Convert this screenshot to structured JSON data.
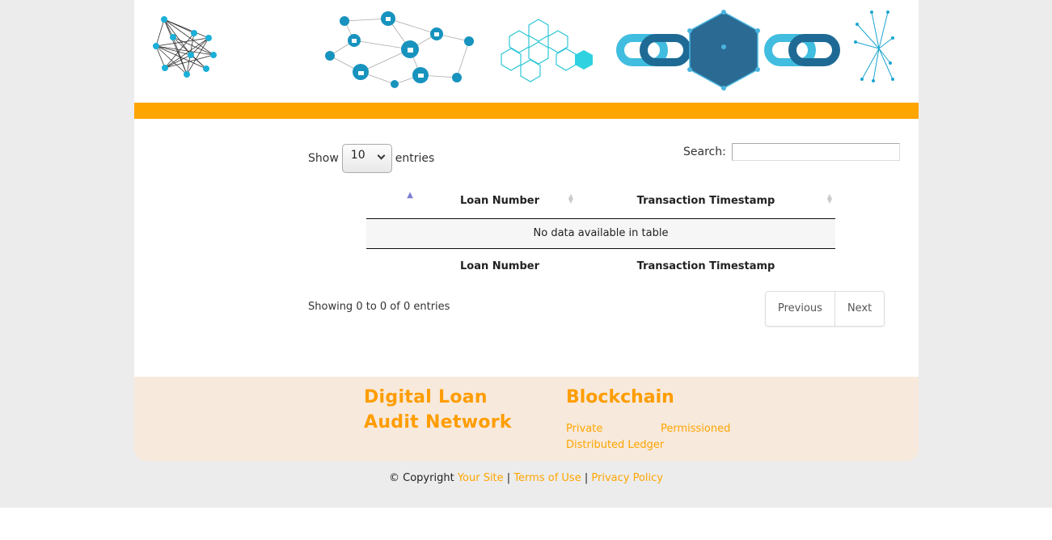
{
  "controls": {
    "show_label": "Show",
    "page_length": "10",
    "entries_label": "entries",
    "search_label": "Search:",
    "search_value": ""
  },
  "table": {
    "columns": [
      "",
      "Loan Number",
      "Transaction Timestamp"
    ],
    "empty_message": "No data available in table",
    "info": "Showing 0 to 0 of 0 entries"
  },
  "pagination": {
    "previous": "Previous",
    "next": "Next"
  },
  "footer": {
    "title": "Digital Loan Audit Network",
    "section_title": "Blockchain",
    "links": [
      "Private",
      "Permissioned",
      "Distributed Ledger"
    ]
  },
  "copyright": {
    "prefix": "© Copyright",
    "site_link": "Your Site",
    "terms_link": "Terms of Use",
    "privacy_link": "Privacy Policy",
    "separator": "|"
  },
  "colors": {
    "accent": "#ffa500",
    "footer_bg": "#f7e9db",
    "network_blue": "#29a9d6",
    "cube_dark": "#2a6a93"
  }
}
